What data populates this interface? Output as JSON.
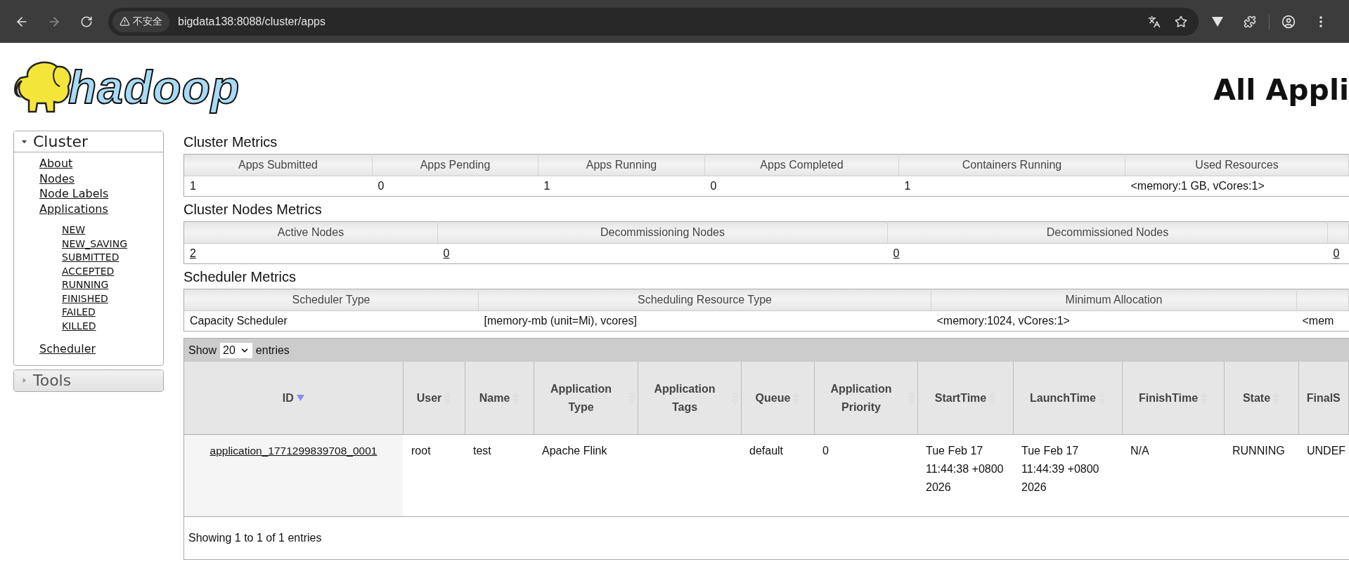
{
  "browser": {
    "security_label": "不安全",
    "url": "bigdata138:8088/cluster/apps"
  },
  "logo": {
    "text": "hadoop"
  },
  "page_title": "All Appli",
  "sidebar": [
    {
      "label": "Cluster",
      "expanded": true,
      "children": [
        {
          "label": "About"
        },
        {
          "label": "Nodes"
        },
        {
          "label": "Node Labels"
        },
        {
          "label": "Applications",
          "children": [
            {
              "label": "NEW"
            },
            {
              "label": "NEW_SAVING"
            },
            {
              "label": "SUBMITTED"
            },
            {
              "label": "ACCEPTED"
            },
            {
              "label": "RUNNING"
            },
            {
              "label": "FINISHED"
            },
            {
              "label": "FAILED"
            },
            {
              "label": "KILLED"
            }
          ]
        },
        {
          "label": "Scheduler"
        }
      ]
    },
    {
      "label": "Tools",
      "expanded": false
    }
  ],
  "metrics": [
    {
      "title": "Cluster Metrics",
      "linked": false,
      "columns": [
        "Apps Submitted",
        "Apps Pending",
        "Apps Running",
        "Apps Completed",
        "Containers Running",
        "Used Resources"
      ],
      "values": [
        "1",
        "0",
        "1",
        "0",
        "1",
        "<memory:1 GB, vCores:1>"
      ]
    },
    {
      "title": "Cluster Nodes Metrics",
      "linked": true,
      "columns": [
        "Active Nodes",
        "Decommissioning Nodes",
        "Decommissioned Nodes"
      ],
      "values": [
        "2",
        "0",
        "0",
        "0"
      ]
    },
    {
      "title": "Scheduler Metrics",
      "linked": false,
      "columns": [
        "Scheduler Type",
        "Scheduling Resource Type",
        "Minimum Allocation"
      ],
      "values": [
        "Capacity Scheduler",
        "[memory-mb (unit=Mi), vcores]",
        "<memory:1024, vCores:1>",
        "<mem"
      ]
    }
  ],
  "apps_table": {
    "show_label": "Show",
    "page_size": "20",
    "entries_label": "entries",
    "columns": [
      {
        "label": "ID",
        "sorted": true,
        "kind": "link"
      },
      {
        "label": "User",
        "sorted": false,
        "kind": "text"
      },
      {
        "label": "Name",
        "sorted": false,
        "kind": "text"
      },
      {
        "label": "Application Type",
        "sorted": false,
        "kind": "text"
      },
      {
        "label": "Application Tags",
        "sorted": false,
        "kind": "text"
      },
      {
        "label": "Queue",
        "sorted": false,
        "kind": "text"
      },
      {
        "label": "Application Priority",
        "sorted": false,
        "kind": "text"
      },
      {
        "label": "StartTime",
        "sorted": false,
        "kind": "text"
      },
      {
        "label": "LaunchTime",
        "sorted": false,
        "kind": "text"
      },
      {
        "label": "FinishTime",
        "sorted": false,
        "kind": "text"
      },
      {
        "label": "State",
        "sorted": false,
        "kind": "text"
      },
      {
        "label": "FinalS",
        "kind": "text"
      }
    ],
    "rows": [
      {
        "cells": [
          "application_1771299839708_0001",
          "root",
          "test",
          "Apache Flink",
          "",
          "default",
          "0",
          "Tue Feb 17 11:44:38 +0800 2026",
          "Tue Feb 17 11:44:39 +0800 2026",
          "N/A",
          "RUNNING",
          "UNDEF"
        ]
      }
    ],
    "footer": "Showing 1 to 1 of 1 entries"
  }
}
